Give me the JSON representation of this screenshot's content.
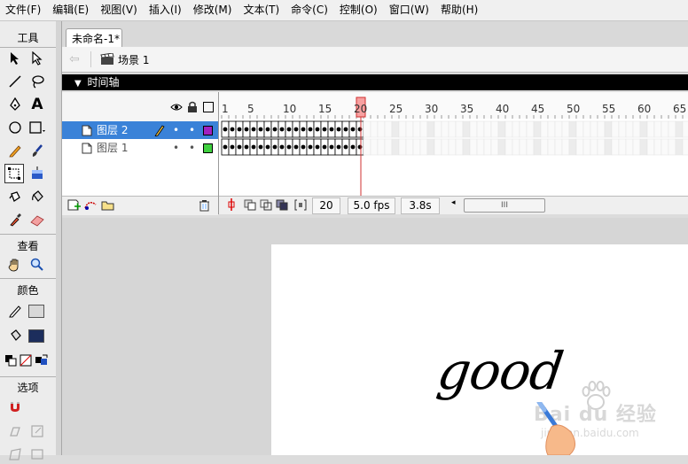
{
  "menubar": {
    "items": [
      "文件(F)",
      "编辑(E)",
      "视图(V)",
      "插入(I)",
      "修改(M)",
      "文本(T)",
      "命令(C)",
      "控制(O)",
      "窗口(W)",
      "帮助(H)"
    ]
  },
  "tools": {
    "title": "工具",
    "view_title": "查看",
    "color_title": "颜色",
    "options_title": "选项",
    "stroke_color": "#d8d8d8",
    "fill_color": "#1c2d5c"
  },
  "document": {
    "tab_title": "未命名-1*",
    "scene_label": "场景 1"
  },
  "timeline": {
    "header": "时间轴",
    "ruler_ticks": [
      "1",
      "5",
      "10",
      "15",
      "20",
      "25",
      "30",
      "35",
      "40",
      "45",
      "50",
      "55",
      "60",
      "65"
    ],
    "playhead_frame": 20,
    "layers": [
      {
        "name": "图层 2",
        "selected": true,
        "outline_color": "#a020c0"
      },
      {
        "name": "图层 1",
        "selected": false,
        "outline_color": "#40d040"
      }
    ],
    "current_frame": "20",
    "fps": "5.0 fps",
    "elapsed": "3.8s"
  },
  "stage": {
    "text": "good",
    "watermark_text": "Bai du 经验",
    "watermark_url": "jingyan.baidu.com"
  }
}
